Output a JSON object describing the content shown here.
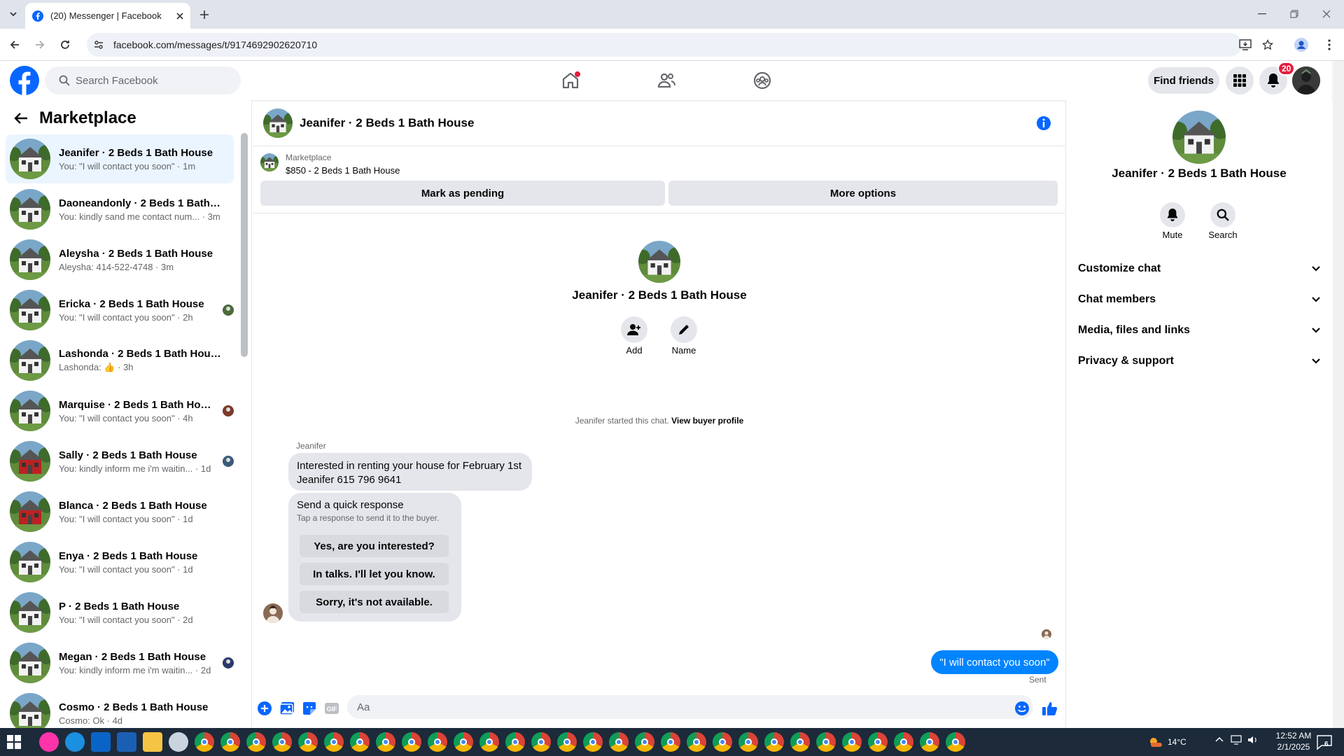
{
  "browser": {
    "tab_title": "(20) Messenger | Facebook",
    "url": "facebook.com/messages/t/9174692902620710"
  },
  "header": {
    "search_placeholder": "Search Facebook",
    "find_friends": "Find friends",
    "notif_count": "20"
  },
  "sidebar": {
    "title": "Marketplace",
    "conversations": [
      {
        "name": "Jeanifer · 2 Beds 1 Bath House",
        "preview": "You: \"I will contact you soon\" · 1m",
        "avatar": "house"
      },
      {
        "name": "Daoneandonly · 2 Beds 1 Bath H...",
        "preview": "You: kindly sand me contact num... · 3m",
        "avatar": "house"
      },
      {
        "name": "Aleysha · 2 Beds 1 Bath House",
        "preview": "Aleysha: 414-522-4748 · 3m",
        "avatar": "house"
      },
      {
        "name": "Ericka · 2 Beds 1 Bath House",
        "preview": "You: \"I will contact you soon\" · 2h",
        "avatar": "house"
      },
      {
        "name": "Lashonda · 2 Beds 1 Bath House",
        "preview": "Lashonda: 👍 · 3h",
        "avatar": "house"
      },
      {
        "name": "Marquise · 2 Beds 1 Bath House",
        "preview": "You: \"I will contact you soon\" · 4h",
        "avatar": "house"
      },
      {
        "name": "Sally · 2 Beds 1 Bath House",
        "preview": "You: kindly inform me i'm waitin... · 1d",
        "avatar": "red-house"
      },
      {
        "name": "Blanca · 2 Beds 1 Bath House",
        "preview": "You: \"I will contact you soon\" · 1d",
        "avatar": "red-house"
      },
      {
        "name": "Enya · 2 Beds 1 Bath House",
        "preview": "You: \"I will contact you soon\" · 1d",
        "avatar": "house"
      },
      {
        "name": "P · 2 Beds 1 Bath House",
        "preview": "You: \"I will contact you soon\" · 2d",
        "avatar": "house"
      },
      {
        "name": "Megan · 2 Beds 1 Bath House",
        "preview": "You: kindly inform me i'm waitin... · 2d",
        "avatar": "house"
      },
      {
        "name": "Cosmo · 2 Beds 1 Bath House",
        "preview": "Cosmo: Ok · 4d",
        "avatar": "house"
      }
    ]
  },
  "chat": {
    "title": "Jeanifer · 2 Beds 1 Bath House",
    "listing_label": "Marketplace",
    "listing_price": "$850 - 2 Beds 1 Bath House",
    "mark_pending": "Mark as pending",
    "more_options": "More options",
    "profile_name": "Jeanifer · 2 Beds 1 Bath House",
    "add_label": "Add",
    "name_label": "Name",
    "started_text": "Jeanifer started this chat.",
    "view_buyer": "View buyer profile",
    "sender": "Jeanifer",
    "message_line1": "Interested in renting your house for February 1st",
    "message_line2": "Jeanifer 615 796 9641",
    "quick_title": "Send a quick response",
    "quick_sub": "Tap a response to send it to the buyer.",
    "quick_replies": [
      "Yes, are you interested?",
      "In talks. I'll let you know.",
      "Sorry, it's not available."
    ],
    "my_message": "\"I will contact you soon\"",
    "sent_label": "Sent",
    "input_placeholder": "Aa"
  },
  "details": {
    "name": "Jeanifer · 2 Beds 1 Bath House",
    "mute": "Mute",
    "search": "Search",
    "sections": [
      "Customize chat",
      "Chat members",
      "Media, files and links",
      "Privacy & support"
    ]
  },
  "taskbar": {
    "temperature": "14°C",
    "time": "12:52 AM",
    "date": "2/1/2025",
    "notif": "6"
  },
  "colors": {
    "fb_blue": "#0866ff",
    "messenger_blue": "#0084ff",
    "badge_red": "#e41e3f"
  }
}
